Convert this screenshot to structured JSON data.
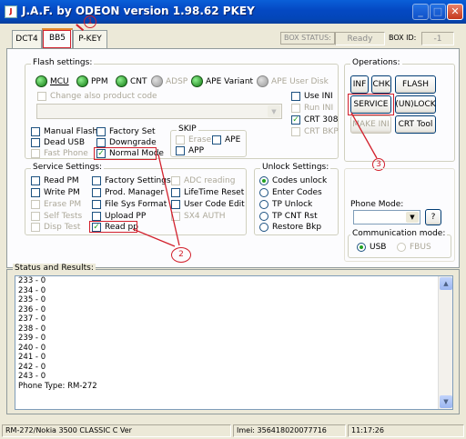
{
  "window": {
    "title": "J.A.F. by ODEON version 1.98.62 PKEY",
    "minimize_glyph": "_",
    "maximize_glyph": "□",
    "close_glyph": "✕"
  },
  "tabs": [
    "DCT4",
    "BB5",
    "P-KEY"
  ],
  "box_status": {
    "label": "BOX STATUS:",
    "value": "Ready",
    "id_label": "BOX ID:",
    "id_value": "-1"
  },
  "flash_settings": {
    "label": "Flash settings:",
    "leds": [
      "MCU",
      "PPM",
      "CNT",
      "ADSP",
      "APE Variant",
      "APE User Disk"
    ],
    "change_product_code": "Change also product code",
    "use_ini": "Use INI",
    "run_ini": "Run INI",
    "crt308": "CRT 308",
    "crt_bkp": "CRT BKP",
    "manual_flash": "Manual Flash",
    "dead_usb": "Dead USB",
    "fast_phone": "Fast Phone",
    "factory_set": "Factory Set",
    "downgrade": "Downgrade",
    "normal_mode": "Normal Mode"
  },
  "skip": {
    "label": "SKIP",
    "erase": "Erase",
    "ape": "APE",
    "app": "APP"
  },
  "operations": {
    "label": "Operations:",
    "inf": "INF",
    "chk": "CHK",
    "flash": "FLASH",
    "service": "SERVICE",
    "unlock": "(UN)LOCK",
    "make_ini": "MAKE INI",
    "crt_tool": "CRT Tool"
  },
  "service_settings": {
    "label": "Service Settings:",
    "col1": [
      "Read PM",
      "Write PM",
      "Erase PM",
      "Self Tests",
      "Disp Test"
    ],
    "col2": [
      "Factory Settings",
      "Prod. Manager",
      "File Sys Format",
      "Upload PP",
      "Read pp"
    ],
    "col3": [
      "ADC reading",
      "LifeTime Reset",
      "User Code Edit",
      "SX4 AUTH"
    ]
  },
  "unlock_settings": {
    "label": "Unlock Settings:",
    "options": [
      "Codes unlock",
      "Enter Codes",
      "TP Unlock",
      "TP CNT Rst",
      "Restore Bkp"
    ]
  },
  "phone_mode": {
    "label": "Phone Mode:",
    "help": "?"
  },
  "communication": {
    "label": "Communication mode:",
    "usb": "USB",
    "fbus": "FBUS"
  },
  "status_results": {
    "label": "Status and Results:",
    "lines": [
      "233 - 0",
      "234 - 0",
      "235 - 0",
      "236 - 0",
      "237 - 0",
      "238 - 0",
      "239 - 0",
      "240 - 0",
      "241 - 0",
      "242 - 0",
      "243 - 0",
      "Phone Type: RM-272"
    ]
  },
  "statusbar": {
    "model": "RM-272/Nokia 3500 CLASSIC C Ver",
    "imei": "Imei: 356418020077716",
    "time": "11:17:26"
  },
  "annotations": [
    "1",
    "2",
    "3"
  ],
  "colors": {
    "accent": "#d2202c",
    "title_bar": "#0448c2",
    "led_on": "#21a121"
  }
}
